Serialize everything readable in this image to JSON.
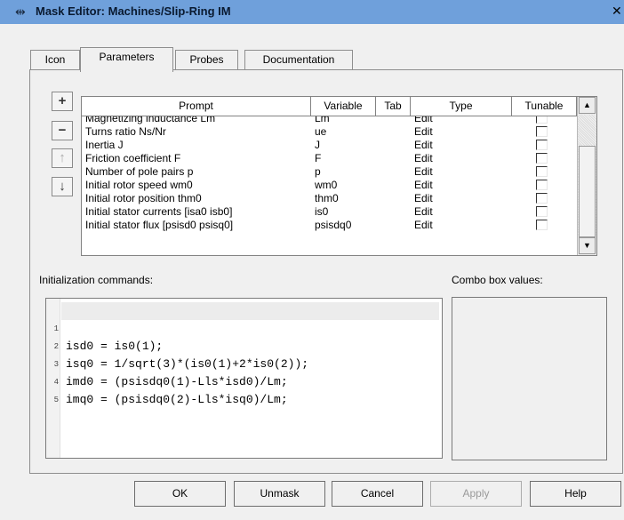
{
  "window": {
    "title": "Mask Editor: Machines/Slip-Ring IM",
    "app_icon": "simulink-block-icon",
    "close_glyph": "✕"
  },
  "tabs": [
    {
      "label": "Icon",
      "active": false
    },
    {
      "label": "Parameters",
      "active": true
    },
    {
      "label": "Probes",
      "active": false
    },
    {
      "label": "Documentation",
      "active": false
    }
  ],
  "side_buttons": {
    "add": "+",
    "remove": "−",
    "move_up": "↑",
    "move_down": "↓"
  },
  "table": {
    "columns": [
      "Prompt",
      "Variable",
      "Tab",
      "Type",
      "Tunable"
    ],
    "rows": [
      {
        "prompt": "Magnetizing inductance Lm",
        "variable": "Lm",
        "tab": "",
        "type": "Edit",
        "tunable": false
      },
      {
        "prompt": "Turns ratio Ns/Nr",
        "variable": "ue",
        "tab": "",
        "type": "Edit",
        "tunable": false
      },
      {
        "prompt": "Inertia J",
        "variable": "J",
        "tab": "",
        "type": "Edit",
        "tunable": false
      },
      {
        "prompt": "Friction coefficient F",
        "variable": "F",
        "tab": "",
        "type": "Edit",
        "tunable": false
      },
      {
        "prompt": "Number of pole pairs p",
        "variable": "p",
        "tab": "",
        "type": "Edit",
        "tunable": false
      },
      {
        "prompt": "Initial rotor speed wm0",
        "variable": "wm0",
        "tab": "",
        "type": "Edit",
        "tunable": false
      },
      {
        "prompt": "Initial rotor position thm0",
        "variable": "thm0",
        "tab": "",
        "type": "Edit",
        "tunable": false
      },
      {
        "prompt": "Initial stator currents [isa0 isb0]",
        "variable": "is0",
        "tab": "",
        "type": "Edit",
        "tunable": false
      },
      {
        "prompt": "Initial stator flux [psisd0 psisq0]",
        "variable": "psisdq0",
        "tab": "",
        "type": "Edit",
        "tunable": false
      }
    ]
  },
  "init_commands": {
    "label": "Initialization commands:",
    "lines": [
      {
        "num": "1",
        "code": "isd0 = is0(1);"
      },
      {
        "num": "2",
        "code": "isq0 = 1/sqrt(3)*(is0(1)+2*is0(2));"
      },
      {
        "num": "3",
        "code": "imd0 = (psisdq0(1)-Lls*isd0)/Lm;"
      },
      {
        "num": "4",
        "code": "imq0 = (psisdq0(2)-Lls*isq0)/Lm;"
      },
      {
        "num": "5",
        "code": ""
      }
    ]
  },
  "combo_box": {
    "label": "Combo box values:"
  },
  "buttons": {
    "ok": "OK",
    "unmask": "Unmask",
    "cancel": "Cancel",
    "apply": "Apply",
    "help": "Help"
  },
  "colors": {
    "titlebar": "#6fa0db",
    "window_bg": "#f0f0f0"
  }
}
